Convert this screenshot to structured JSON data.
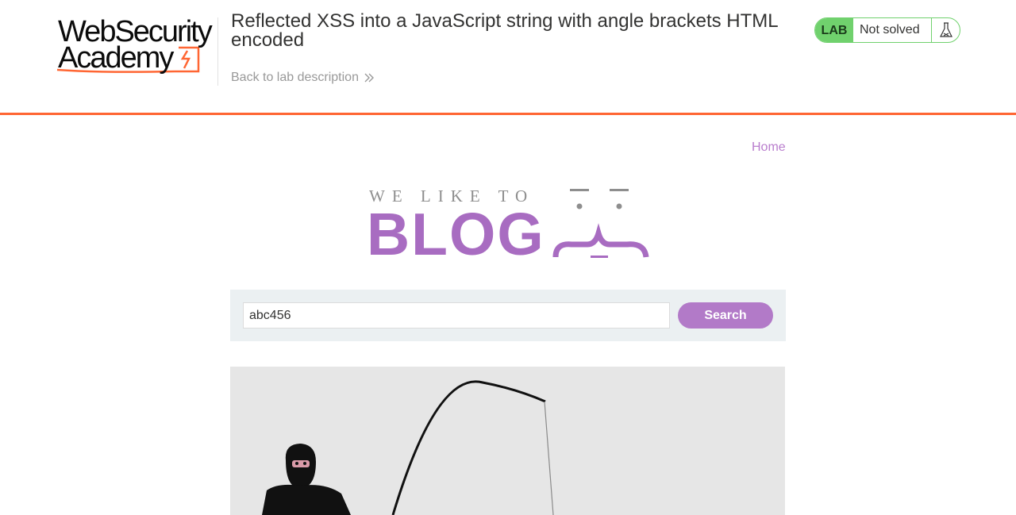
{
  "header": {
    "logo_line1": "WebSecurity",
    "logo_line2": "Academy",
    "lab_title": "Reflected XSS into a JavaScript string with angle brackets HTML encoded",
    "back_link": "Back to lab description",
    "lab_badge": "LAB",
    "lab_status": "Not solved",
    "flask_icon": "flask-icon",
    "accent_color": "#ff6633",
    "status_color": "#70d16d"
  },
  "nav": {
    "home": "Home"
  },
  "banner": {
    "top_text": "WE LIKE TO",
    "main_text": "BLOG",
    "brand_color": "#a86cc1"
  },
  "search": {
    "value": "abc456",
    "button_label": "Search"
  },
  "post": {
    "image_icon": "hacker-fishing-image"
  }
}
